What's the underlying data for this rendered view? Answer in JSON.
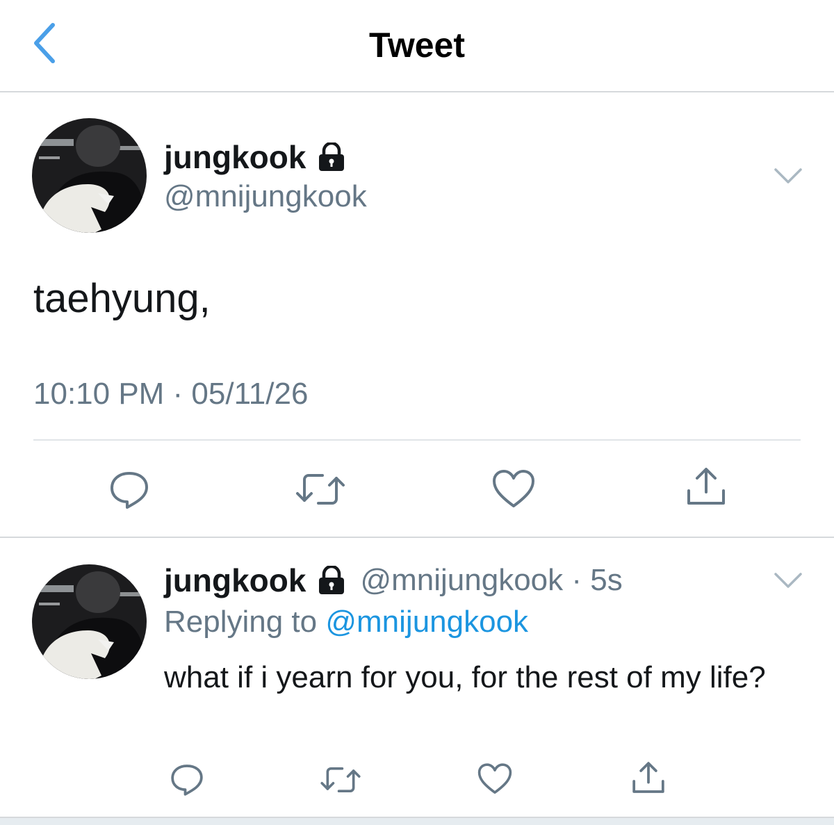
{
  "nav": {
    "title": "Tweet"
  },
  "tweet": {
    "author_name": "jungkook",
    "handle": "@mnijungkook",
    "text": "taehyung,",
    "timestamp": "10:10 PM · 05/11/26"
  },
  "reply": {
    "author_name": "jungkook",
    "handle_time": "@mnijungkook · 5s",
    "replying_prefix": "Replying to ",
    "replying_to": "@mnijungkook",
    "text": "what if i yearn for you, for the rest of my life?"
  },
  "colors": {
    "accent": "#1b95e0",
    "back_arrow": "#4a9fe8",
    "secondary_text": "#657786",
    "icon_gray": "#657786"
  },
  "icons": {
    "back": "chevron-left-icon",
    "lock": "lock-icon",
    "menu": "chevron-down-icon",
    "reply": "comment-icon",
    "retweet": "retweet-icon",
    "like": "heart-icon",
    "share": "share-icon"
  }
}
